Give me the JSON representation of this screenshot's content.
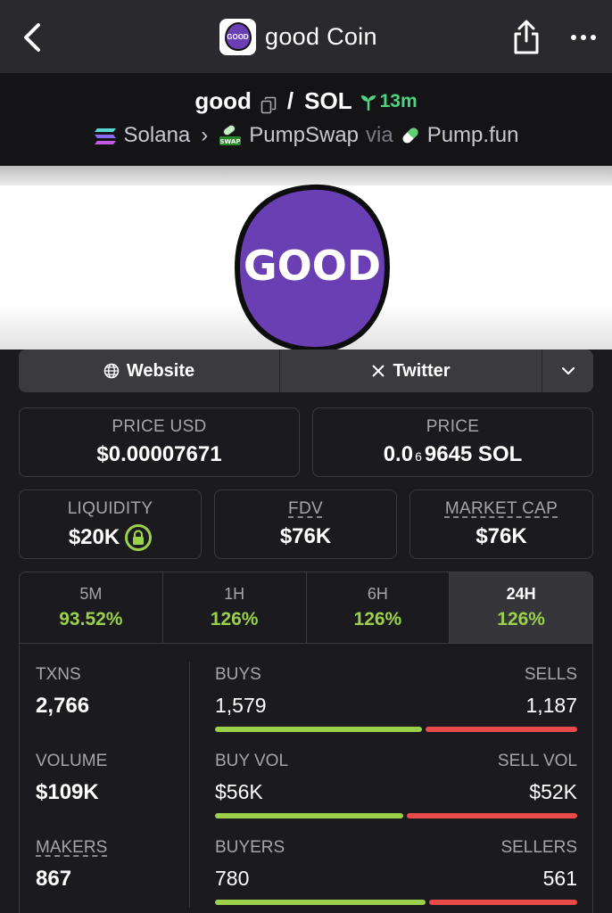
{
  "header": {
    "title": "good Coin",
    "logo_text": "GOOD"
  },
  "pair": {
    "base": "good",
    "quote": "SOL",
    "age": "13m",
    "chain": "Solana",
    "dex": "PumpSwap",
    "via": "via",
    "launchpad": "Pump.fun"
  },
  "banner": {
    "coin_text": "GOOD"
  },
  "links": {
    "website": "Website",
    "twitter": "Twitter"
  },
  "stats": {
    "price_usd_label": "PRICE USD",
    "price_usd": "$0.00007671",
    "price_label": "PRICE",
    "price_sol_prefix": "0.0",
    "price_sol_zeros": "6",
    "price_sol_suffix": "9645 SOL",
    "liquidity_label": "LIQUIDITY",
    "liquidity": "$20K",
    "fdv_label": "FDV",
    "fdv": "$76K",
    "mcap_label": "MARKET CAP",
    "mcap": "$76K"
  },
  "timeframes": [
    {
      "label": "5M",
      "change": "93.52%"
    },
    {
      "label": "1H",
      "change": "126%"
    },
    {
      "label": "6H",
      "change": "126%"
    },
    {
      "label": "24H",
      "change": "126%"
    }
  ],
  "activity": {
    "txns_label": "TXNS",
    "txns": "2,766",
    "volume_label": "VOLUME",
    "volume": "$109K",
    "makers_label": "MAKERS",
    "makers": "867",
    "buys_label": "BUYS",
    "buys": "1,579",
    "sells_label": "SELLS",
    "sells": "1,187",
    "buy_vol_label": "BUY VOL",
    "buy_vol": "$56K",
    "sell_vol_label": "SELL VOL",
    "sell_vol": "$52K",
    "buyers_label": "BUYERS",
    "buyers": "780",
    "sellers_label": "SELLERS",
    "sellers": "561",
    "buys_share": 0.571,
    "buy_vol_share": 0.52,
    "buyers_share": 0.582
  },
  "colors": {
    "accent_green": "#9ad04a",
    "sell_red": "#ea4a4a",
    "age_green": "#4dd47c",
    "coin_purple": "#6a3fb4"
  }
}
